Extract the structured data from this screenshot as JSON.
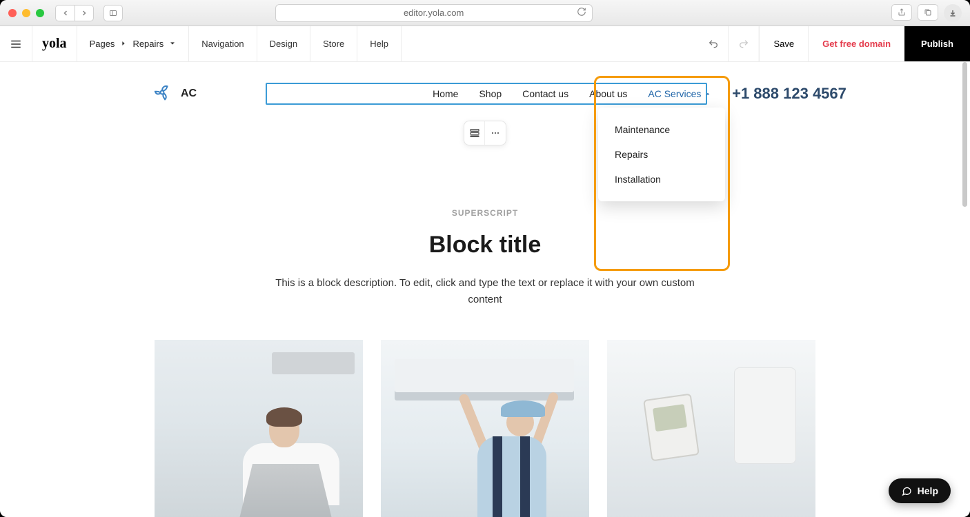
{
  "browser": {
    "url": "editor.yola.com"
  },
  "toolbar": {
    "pages_label": "Pages",
    "current_page": "Repairs",
    "nav_items": [
      "Navigation",
      "Design",
      "Store",
      "Help"
    ],
    "save_label": "Save",
    "domain_label": "Get free domain",
    "publish_label": "Publish"
  },
  "site": {
    "brand_name": "AC",
    "nav": [
      "Home",
      "Shop",
      "Contact us",
      "About us"
    ],
    "nav_active": "AC Services",
    "phone": "+1 888 123 4567",
    "dropdown": [
      "Maintenance",
      "Repairs",
      "Installation"
    ],
    "superscript": "SUPERSCRIPT",
    "title": "Block title",
    "description": "This is a block description. To edit, click and type the text or replace it with your own custom content"
  },
  "help_fab": "Help"
}
